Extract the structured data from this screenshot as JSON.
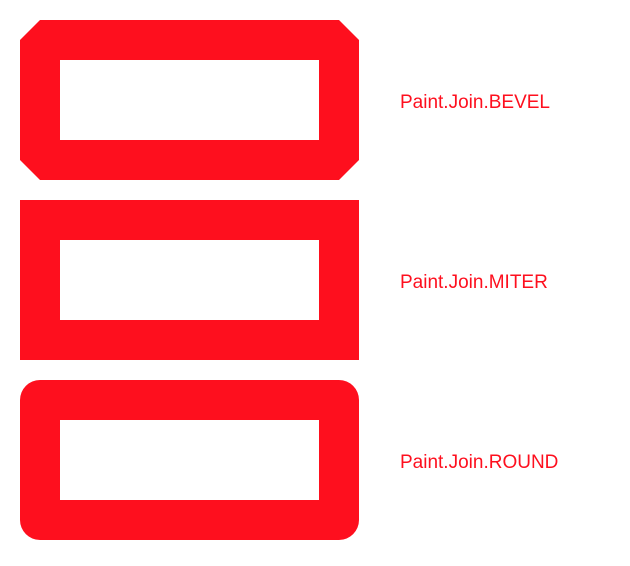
{
  "colors": {
    "stroke": "#fe0f1e",
    "label": "#fe0f1e",
    "background": "#ffffff"
  },
  "joins": [
    {
      "label": "Paint.Join.BEVEL",
      "join": "bevel"
    },
    {
      "label": "Paint.Join.MITER",
      "join": "miter"
    },
    {
      "label": "Paint.Join.ROUND",
      "join": "round"
    }
  ]
}
